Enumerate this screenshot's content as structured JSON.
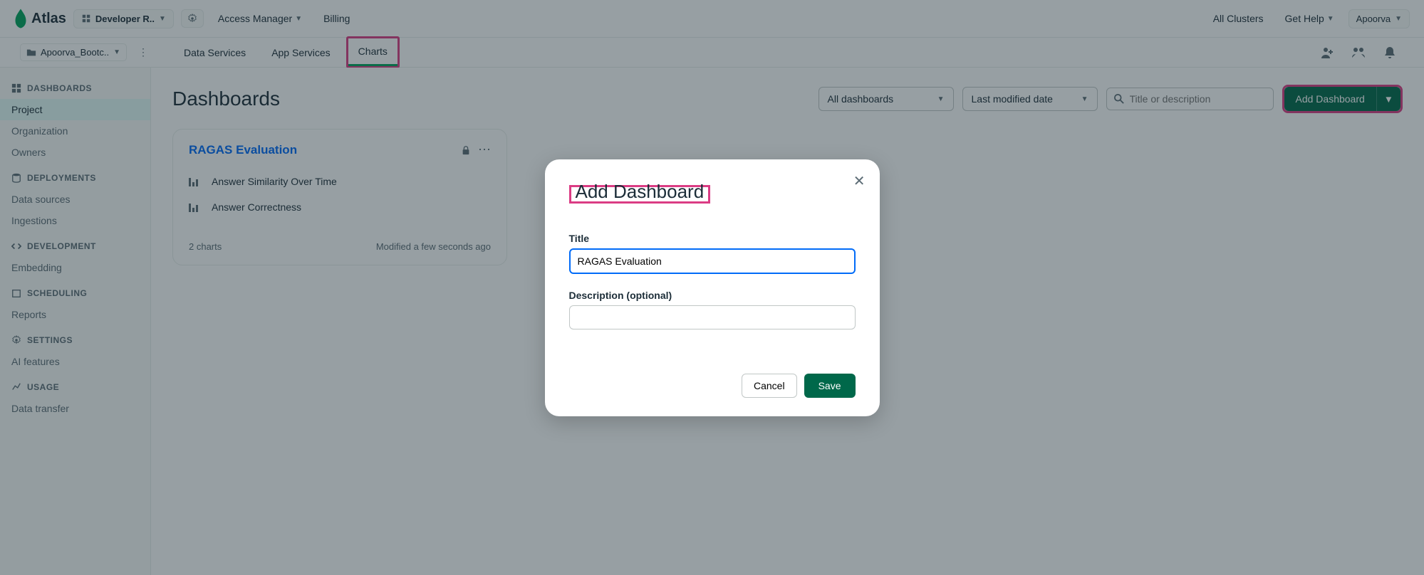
{
  "topnav": {
    "brand": "Atlas",
    "org_picker": "Developer R..",
    "access_manager": "Access Manager",
    "billing": "Billing",
    "all_clusters": "All Clusters",
    "get_help": "Get Help",
    "user": "Apoorva"
  },
  "subnav": {
    "project": "Apoorva_Bootc..",
    "tabs": {
      "data_services": "Data Services",
      "app_services": "App Services",
      "charts": "Charts"
    }
  },
  "sidebar": {
    "dashboards_heading": "DASHBOARDS",
    "dashboards_items": [
      "Project",
      "Organization",
      "Owners"
    ],
    "deployments_heading": "DEPLOYMENTS",
    "deployments_items": [
      "Data sources",
      "Ingestions"
    ],
    "development_heading": "DEVELOPMENT",
    "development_items": [
      "Embedding"
    ],
    "scheduling_heading": "SCHEDULING",
    "scheduling_items": [
      "Reports"
    ],
    "settings_heading": "SETTINGS",
    "settings_items": [
      "AI features"
    ],
    "usage_heading": "USAGE",
    "usage_items": [
      "Data transfer"
    ]
  },
  "main": {
    "page_title": "Dashboards",
    "filter_dropdown": "All dashboards",
    "sort_dropdown": "Last modified date",
    "search_placeholder": "Title or description",
    "add_dashboard_btn": "Add Dashboard"
  },
  "card": {
    "title": "RAGAS Evaluation",
    "charts": [
      "Answer Similarity Over Time",
      "Answer Correctness"
    ],
    "chart_count": "2 charts",
    "modified": "Modified a few seconds ago"
  },
  "modal": {
    "title": "Add Dashboard",
    "title_label": "Title",
    "title_value": "RAGAS Evaluation",
    "desc_label": "Description (optional)",
    "cancel": "Cancel",
    "save": "Save"
  }
}
